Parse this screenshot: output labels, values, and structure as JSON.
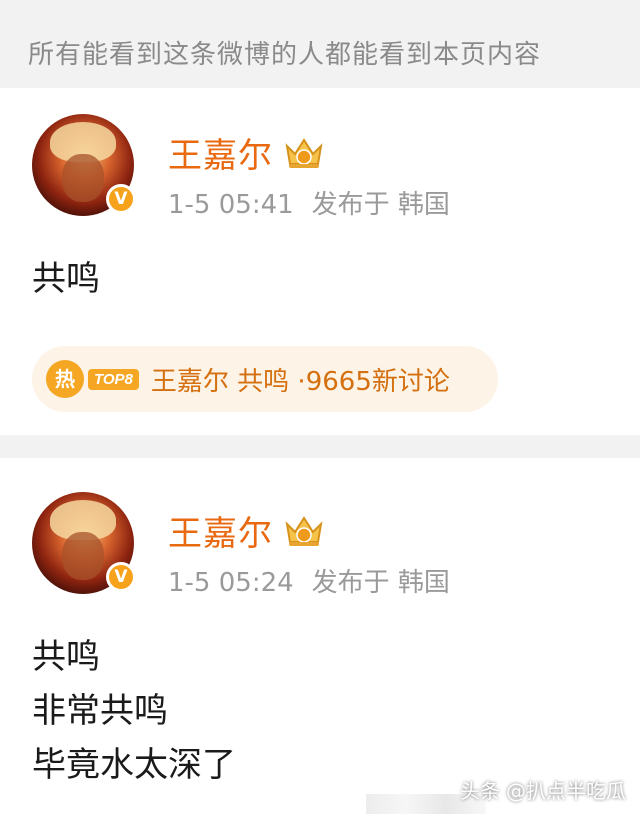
{
  "notice": "所有能看到这条微博的人都能看到本页内容",
  "posts": [
    {
      "user": "王嘉尔",
      "time": "1-5 05:41",
      "location": "发布于 韩国",
      "lines": [
        "共鸣"
      ],
      "topic": {
        "hot_label": "热",
        "rank": "TOP8",
        "text": "王嘉尔 共鸣 ·9665新讨论"
      }
    },
    {
      "user": "王嘉尔",
      "time": "1-5 05:24",
      "location": "发布于 韩国",
      "lines": [
        "共鸣",
        "非常共鸣",
        "毕竟水太深了"
      ]
    }
  ],
  "badge": "V",
  "watermark": {
    "source": "头条",
    "handle": "@扒点半吃瓜"
  },
  "colors": {
    "username": "#e8690f",
    "verify_badge": "#f7a21b",
    "topic_text": "#d4700f",
    "topic_bg": "#fdf3e6"
  },
  "icons": {
    "member": "crown-icon",
    "verified": "verified-badge-icon",
    "hot": "hot-icon"
  }
}
